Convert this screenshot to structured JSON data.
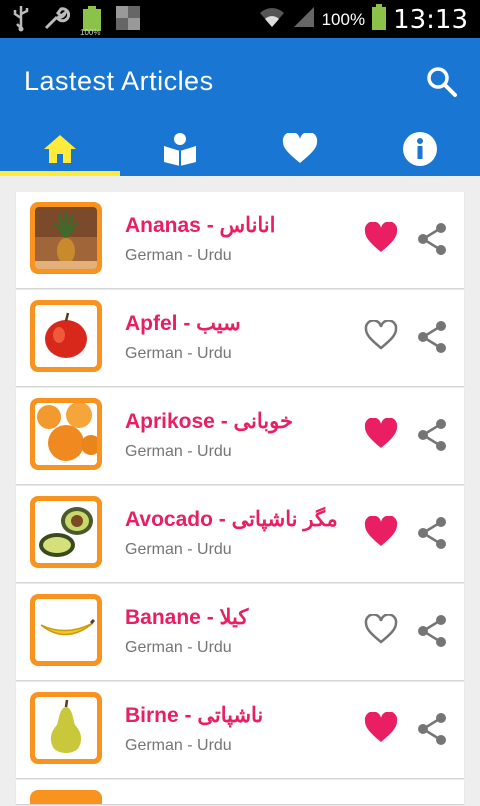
{
  "status": {
    "battery_pct": "100%",
    "small_battery_pct": "100%",
    "time": "13:13"
  },
  "appbar": {
    "title": "Lastest Articles",
    "search_icon": "search-icon",
    "color": "#1976d2",
    "tab_indicator_color": "#ffeb3b"
  },
  "tabs": [
    {
      "icon": "home-icon",
      "active": true
    },
    {
      "icon": "reader-icon",
      "active": false
    },
    {
      "icon": "heart-icon",
      "active": false
    },
    {
      "icon": "info-icon",
      "active": false
    }
  ],
  "articles": [
    {
      "name": "Ananas",
      "translation": "اناناس",
      "languages": "German - Urdu",
      "favorite": true,
      "image": "pineapple"
    },
    {
      "name": "Apfel",
      "translation": "سیب",
      "languages": "German - Urdu",
      "favorite": false,
      "image": "apple"
    },
    {
      "name": "Aprikose",
      "translation": "خوبانی",
      "languages": "German - Urdu",
      "favorite": true,
      "image": "apricot"
    },
    {
      "name": "Avocado",
      "translation": "مگر ناشپاتی",
      "languages": "German - Urdu",
      "favorite": true,
      "image": "avocado"
    },
    {
      "name": "Banane",
      "translation": "کیلا",
      "languages": "German - Urdu",
      "favorite": false,
      "image": "banana"
    },
    {
      "name": "Birne",
      "translation": "ناشپاتی",
      "languages": "German - Urdu",
      "favorite": true,
      "image": "pear"
    }
  ],
  "colors": {
    "title_pink": "#e91e63",
    "thumb_orange": "#f7931e"
  }
}
